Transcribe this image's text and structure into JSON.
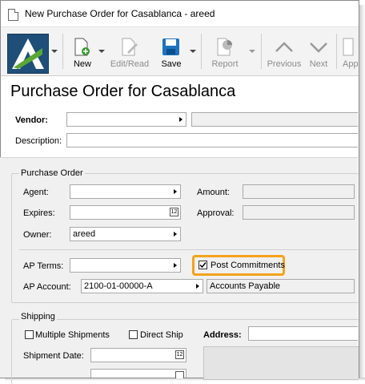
{
  "window": {
    "title": "New Purchase Order for Casablanca - areed"
  },
  "toolbar": {
    "new_label": "New",
    "edit_read_label": "Edit/Read",
    "save_label": "Save",
    "report_label": "Report",
    "previous_label": "Previous",
    "next_label": "Next",
    "approve_label": "Appro"
  },
  "page": {
    "title": "Purchase Order for Casablanca"
  },
  "vendor": {
    "label": "Vendor:",
    "value": ""
  },
  "description": {
    "label": "Description:",
    "value": ""
  },
  "po": {
    "group_label": "Purchase Order",
    "agent_label": "Agent:",
    "agent_value": "",
    "expires_label": "Expires:",
    "expires_value": "",
    "owner_label": "Owner:",
    "owner_value": "areed",
    "amount_label": "Amount:",
    "amount_value": "",
    "approval_label": "Approval:",
    "approval_value": "",
    "ap_terms_label": "AP Terms:",
    "ap_terms_value": "",
    "ap_account_label": "AP Account:",
    "ap_account_value": "2100-01-00000-A",
    "ap_account_desc": "Accounts Payable",
    "post_commitments_label": "Post Commitments",
    "post_commitments_checked": true
  },
  "shipping": {
    "group_label": "Shipping",
    "multiple_label": "Multiple Shipments",
    "direct_label": "Direct Ship",
    "address_label": "Address:",
    "address_value": "",
    "date_label": "Shipment Date:",
    "date_value": "",
    "calendar_glyph": "12"
  },
  "colors": {
    "highlight": "#f4a21c",
    "logo_bg": "#1f4e79",
    "save_blue": "#1e73be"
  }
}
